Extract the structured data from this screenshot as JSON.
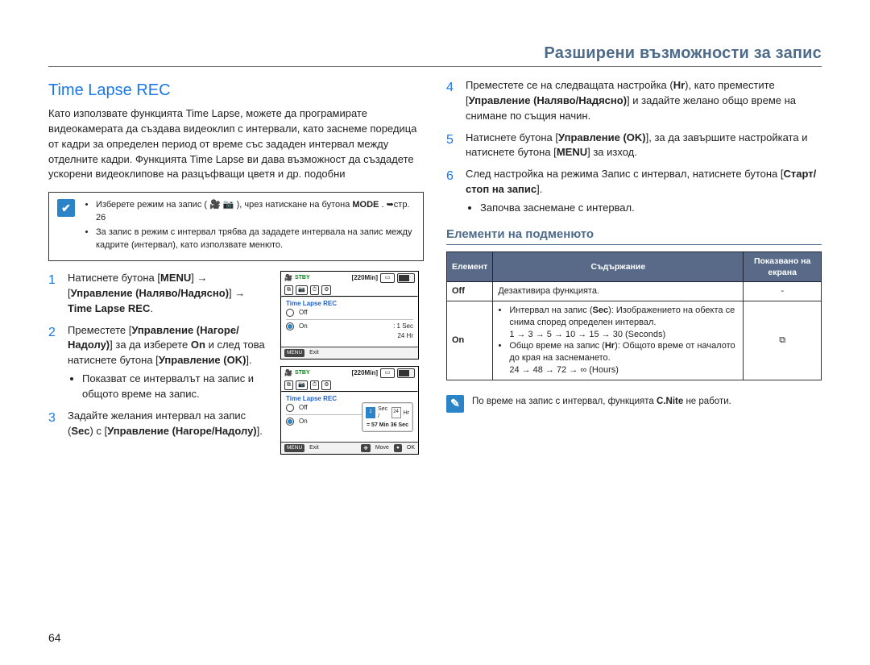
{
  "chapter_title": "Разширени възможности за запис",
  "section_title": "Time Lapse REC",
  "intro": "Като използвате функцията Time Lapse, можете да програмирате видеокамерата да създава видеоклип с интервали, като заснеме поредица от кадри за определен период от време със зададен интервал между отделните кадри. Функцията Time Lapse ви дава възможност да създадете ускорени видеоклипове на разцъфващи цветя и др. подобни",
  "prereq": {
    "item1_prefix": "Изберете режим на запис ( ",
    "item1_mid": " ), чрез натискане на бутона ",
    "item1_mode": "MODE",
    "item1_pageref": ". ➥стр. 26",
    "item2": "За запис в режим с интервал трябва да зададете интервала на запис между кадрите (интервал), като използвате менюто."
  },
  "steps_left": [
    {
      "num": "1",
      "html": "Натиснете бутона [<b class=\"hw\">MENU</b>] → [<b class=\"hw\">Управление (Наляво/Надясно)</b>] → <b class=\"hw\">Time Lapse REC</b>."
    },
    {
      "num": "2",
      "html": "Преместете [<b class=\"hw\">Управление (Нагоре/Надолу)</b>] за да изберете <b class=\"hw\">On</b> и след това натиснете бутона [<b class=\"hw\">Управление (OK)</b>].",
      "bullets": [
        "Показват се интервалът на запис и общото време на запис."
      ]
    },
    {
      "num": "3",
      "html": "Задайте желания интервал на запис (<b class=\"hw\">Sec</b>) с [<b class=\"hw\">Управление (Нагоре/Надолу)</b>]."
    }
  ],
  "steps_right": [
    {
      "num": "4",
      "html": "Преместете се на следващата настройка (<b class=\"hw\">Hr</b>), като преместите [<b class=\"hw\">Управление (Наляво/Надясно)</b>] и задайте желано общо време на снимане по същия начин."
    },
    {
      "num": "5",
      "html": "Натиснете бутона [<b class=\"hw\">Управление (OK)</b>], за да завършите настройката и натиснете бутона [<b class=\"hw\">MENU</b>] за изход."
    },
    {
      "num": "6",
      "html": "След настройка на режима Запис с интервал, натиснете бутона [<b class=\"hw\">Старт/стоп на запис</b>].",
      "bullets": [
        "Започва заснемане с интервал."
      ]
    }
  ],
  "submenu_heading": "Елементи на подменюто",
  "table": {
    "headers": [
      "Елемент",
      "Съдържание",
      "Показвано на екрана"
    ],
    "rows": [
      {
        "element": "Off",
        "content_plain": "Дезактивира функцията.",
        "icon": "-"
      },
      {
        "element": "On",
        "content_list": [
          "Интервал на запис (<b>Sec</b>): Изображението на обекта се снима според определен интервал.<br>1 → 3 → 5 → 10 → 15 → 30 (Seconds)",
          "Общо време на запис (<b>Hr</b>): Общото време от началото до края на заснемането.<br>24 → 48 → 72 → ∞ (Hours)"
        ],
        "icon": "⧉"
      }
    ]
  },
  "note": "По време на запис с интервал, функцията <b>C.Nite</b> не работи.",
  "page_number": "64",
  "lcd": {
    "stby": "STBY",
    "min220": "[220Min]",
    "title": "Time Lapse REC",
    "off": "Off",
    "on": "On",
    "val1": "1 Sec",
    "val2": "24 Hr",
    "menu": "MENU",
    "exit": "Exit",
    "move": "Move",
    "ok": "OK",
    "popover_sec": "1",
    "popover_seclbl": "Sec /",
    "popover_hr": "24",
    "popover_hrlbl": "Hr",
    "popover_line2": "= 57 Min 36 Sec"
  }
}
